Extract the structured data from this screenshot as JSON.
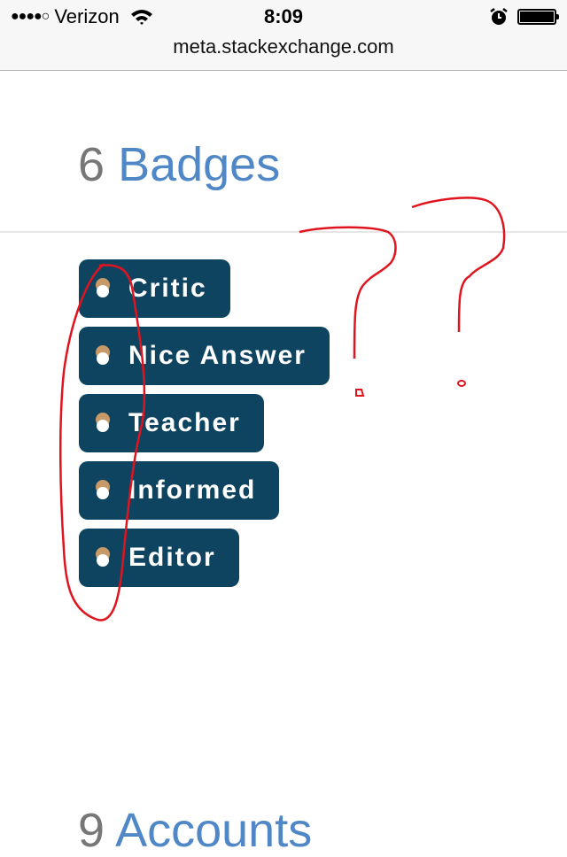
{
  "status_bar": {
    "signal": "●●●●○",
    "carrier": "Verizon",
    "time": "8:09",
    "url": "meta.stackexchange.com",
    "icons": [
      "wifi-icon",
      "alarm-icon",
      "battery-icon"
    ]
  },
  "badges_section": {
    "count": "6",
    "label": "Badges",
    "items": [
      {
        "name": "Critic",
        "tier": "bronze"
      },
      {
        "name": "Nice Answer",
        "tier": "bronze"
      },
      {
        "name": "Teacher",
        "tier": "bronze"
      },
      {
        "name": "Informed",
        "tier": "bronze"
      },
      {
        "name": "Editor",
        "tier": "bronze"
      }
    ]
  },
  "accounts_section": {
    "count": "9",
    "label": "Accounts"
  },
  "colors": {
    "badge_background": "#0e4460",
    "bronze": "#c79a68",
    "section_label": "#5087c6",
    "count": "#777777",
    "annotation": "#e0141e"
  }
}
